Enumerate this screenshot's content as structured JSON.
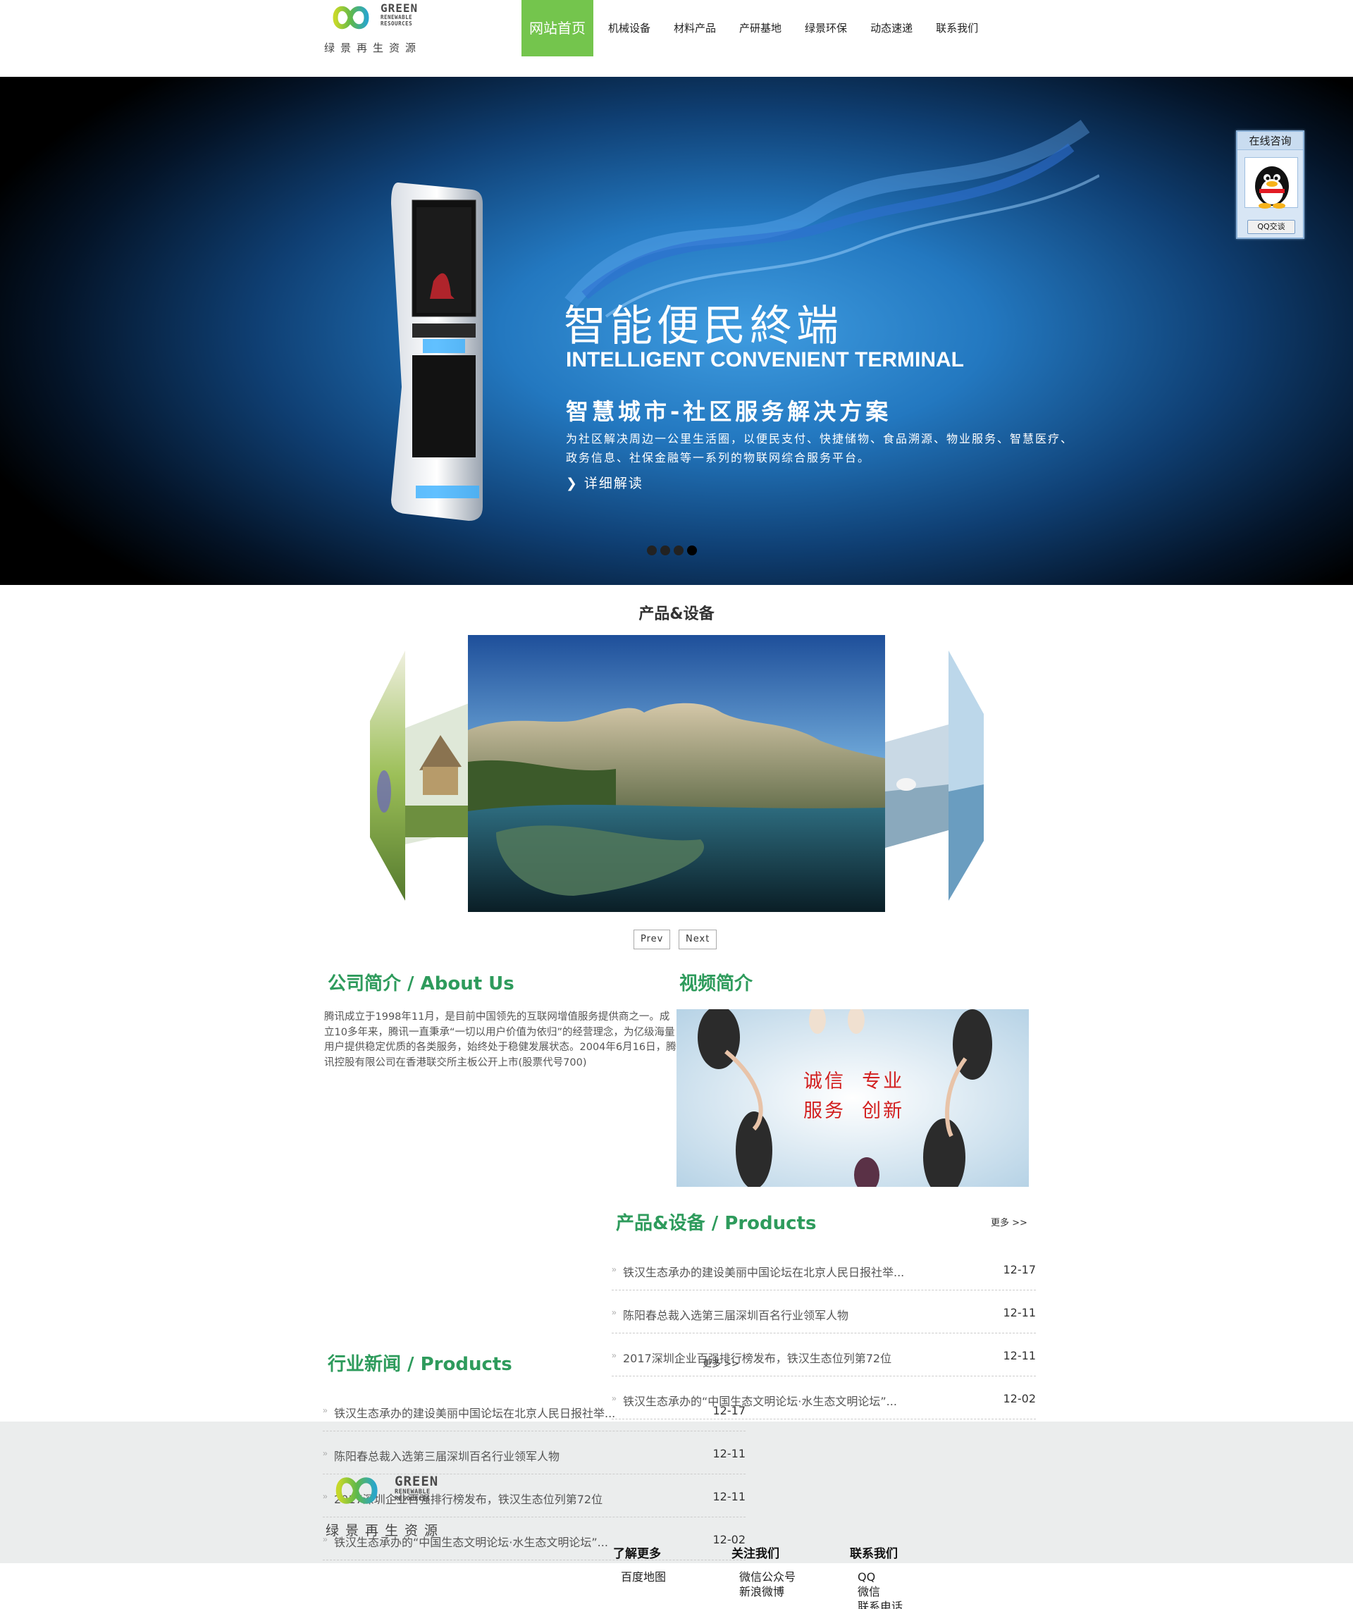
{
  "header": {
    "logo_en_big": "GREEN",
    "logo_en_small_1": "RENEWABLE",
    "logo_en_small_2": "RESOURCES",
    "logo_cn": "绿景再生资源",
    "nav": [
      "网站首页",
      "机械设备",
      "材料产品",
      "产研基地",
      "绿景环保",
      "动态速递",
      "联系我们"
    ],
    "active_nav_index": 0,
    "accent_color": "#74c54d"
  },
  "banner": {
    "title_cn": "智能便民終端",
    "title_en": "INTELLIGENT CONVENIENT TERMINAL",
    "subtitle": "智慧城市-社区服务解决方案",
    "description": "为社区解决周边一公里生活圈，以便民支付、快捷储物、食品溯源、物业服务、智慧医疗、政务信息、社保金融等一系列的物联网综合服务平台。",
    "more": "详细解读",
    "slide_count": 4,
    "active_slide": 4
  },
  "qq_widget": {
    "title": "在线咨询",
    "button": "QQ交谈",
    "icon": "qq-penguin-icon"
  },
  "products_carousel": {
    "title": "产品&设备",
    "prev": "Prev",
    "next": "Next"
  },
  "about": {
    "title": "公司简介 / About Us",
    "text": "腾讯成立于1998年11月，是目前中国领先的互联网增值服务提供商之一。成立10多年来，腾讯一直秉承“一切以用户价值为依归”的经营理念，为亿级海量用户提供稳定优质的各类服务，始终处于稳健发展状态。2004年6月16日，腾讯控股有限公司在香港联交所主板公开上市(股票代号700)"
  },
  "video": {
    "title": "视频简介",
    "image_text_1": "诚信  专业",
    "image_text_2": "服务  创新"
  },
  "products_news": {
    "title": "产品&设备 / Products",
    "more": "更多 >>",
    "items": [
      {
        "title": "铁汉生态承办的建设美丽中国论坛在北京人民日报社举...",
        "date": "12-17"
      },
      {
        "title": "陈阳春总裁入选第三届深圳百名行业领军人物",
        "date": "12-11"
      },
      {
        "title": "2017深圳企业百强排行榜发布，铁汉生态位列第72位",
        "date": "12-11"
      },
      {
        "title": "铁汉生态承办的“中国生态文明论坛·水生态文明论坛”...",
        "date": "12-02"
      }
    ]
  },
  "industry_news": {
    "title": "行业新闻 / Products",
    "more": "更多 >>",
    "items": [
      {
        "title": "铁汉生态承办的建设美丽中国论坛在北京人民日报社举...",
        "date": "12-17"
      },
      {
        "title": "陈阳春总裁入选第三届深圳百名行业领军人物",
        "date": "12-11"
      },
      {
        "title": "2017深圳企业百强排行榜发布，铁汉生态位列第72位",
        "date": "12-11"
      },
      {
        "title": "铁汉生态承办的“中国生态文明论坛·水生态文明论坛”...",
        "date": "12-02"
      }
    ]
  },
  "footer": {
    "col1": {
      "title": "了解更多",
      "links": [
        "百度地图"
      ]
    },
    "col2": {
      "title": "关注我们",
      "links": [
        "微信公众号",
        "新浪微博"
      ]
    },
    "col3": {
      "title": "联系我们",
      "links": [
        "QQ",
        "微信",
        "联系电话"
      ]
    }
  }
}
